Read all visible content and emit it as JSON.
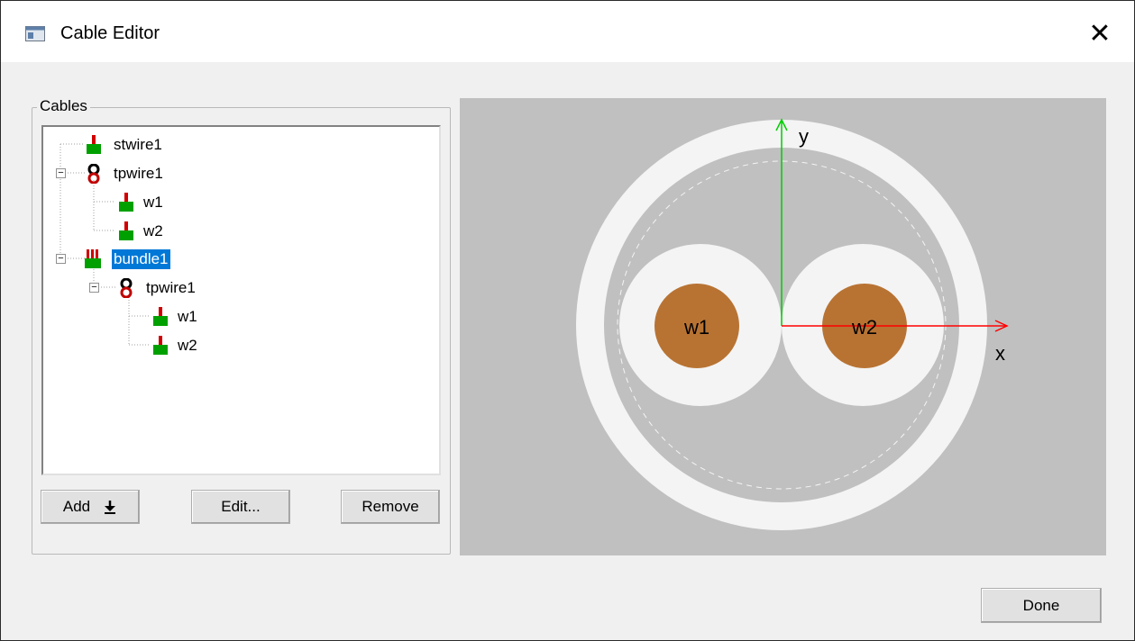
{
  "window": {
    "title": "Cable Editor",
    "close_glyph": "✕"
  },
  "cables_group": {
    "label": "Cables",
    "tree": [
      {
        "label": "stwire1",
        "icon": "single-wire-icon"
      },
      {
        "label": "tpwire1",
        "icon": "twisted-pair-icon",
        "expanded": true
      },
      {
        "label": "w1",
        "icon": "single-wire-icon"
      },
      {
        "label": "w2",
        "icon": "single-wire-icon"
      },
      {
        "label": "bundle1",
        "icon": "bundle-icon",
        "expanded": true,
        "selected": true
      },
      {
        "label": "tpwire1",
        "icon": "twisted-pair-icon",
        "expanded": true
      },
      {
        "label": "w1",
        "icon": "single-wire-icon"
      },
      {
        "label": "w2",
        "icon": "single-wire-icon"
      }
    ]
  },
  "buttons": {
    "add": "Add",
    "add_arrow": "🠗",
    "edit": "Edit...",
    "remove": "Remove",
    "done": "Done"
  },
  "preview": {
    "axis_y": "y",
    "axis_x": "x",
    "wire_labels": [
      "w1",
      "w2"
    ],
    "colors": {
      "background": "#c0c0c0",
      "insulation": "#f4f4f4",
      "conductor": "#b87333",
      "x_axis": "#ff0000",
      "y_axis": "#00cc00"
    }
  }
}
